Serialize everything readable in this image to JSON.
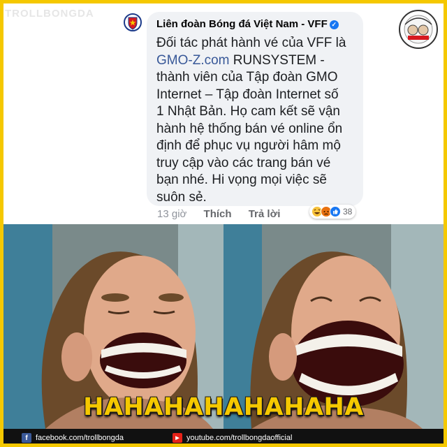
{
  "watermark": "TROLLBONGDA",
  "comment": {
    "author": "Liên đoàn Bóng đá Việt Nam - VFF",
    "lines": [
      "Đối tác phát hành vé của VFF là",
      "RUNSYSTEM -",
      "thành viên của Tập đoàn GMO",
      "Internet – Tập đoàn Internet số",
      "1 Nhật Bản. Họ cam kết sẽ vận",
      "hành hệ thống bán vé online ổn",
      "định để phục vụ người hâm mộ",
      "truy cập vào các trang bán vé",
      "bạn nhé. Hi vọng mọi việc sẽ",
      "suôn sẻ."
    ],
    "link": "GMO-Z.com",
    "time": "13 giờ",
    "like_label": "Thích",
    "reply_label": "Trả lời",
    "reaction_count": "38",
    "reactions": [
      "haha-icon",
      "angry-icon",
      "like-icon"
    ]
  },
  "caption": "HAHAHAHAHAHAHA",
  "footer": {
    "facebook": "facebook.com/trollbongda",
    "youtube": "youtube.com/trollbongdaofficial"
  },
  "colors": {
    "frame": "#f5c800",
    "link": "#385898",
    "bubble": "#f0f2f5"
  }
}
